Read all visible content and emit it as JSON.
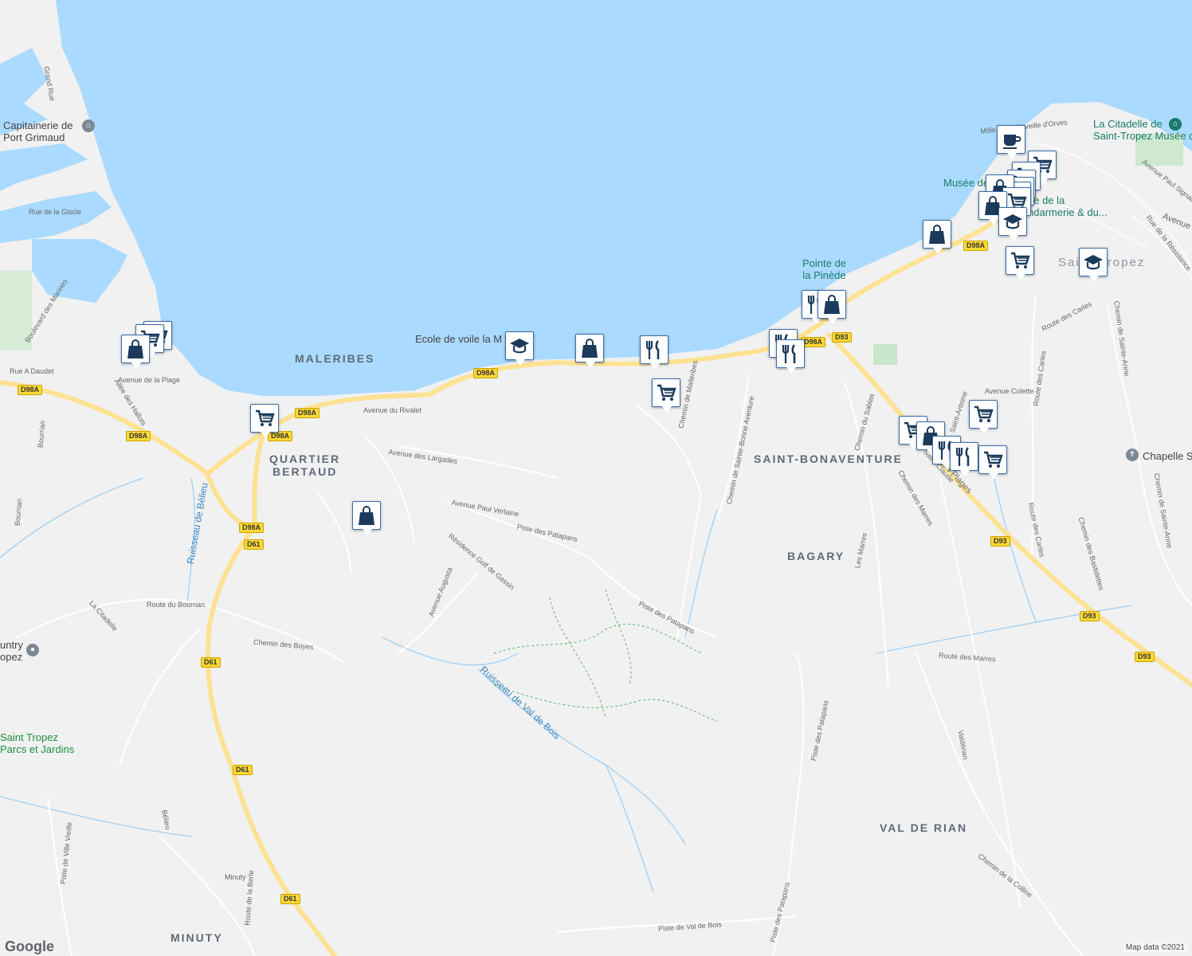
{
  "areas": {
    "malerbes": "MALERIBES",
    "quartier": "QUARTIER",
    "bertaud": "BERTAUD",
    "saint_bonaventure": "SAINT-BONAVENTURE",
    "bagary": "BAGARY",
    "val_de_rian": "VAL DE RIAN",
    "minuty": "MINUTY"
  },
  "pois": {
    "capitainerie_1": "Capitainerie de",
    "capitainerie_2": "Port Grimaud",
    "ecole_voile": "Ecole de voile la M",
    "pointe_1": "Pointe de",
    "pointe_2": "la Pinède",
    "citadelle_1": "La Citadelle de",
    "citadelle_2": "Saint-Tropez Musée d...",
    "musee_1": "Musée de",
    "musee_2": "ée de la",
    "musee_3": "ndarmerie & du...",
    "saint_tropez": "Saint-Tropez",
    "chapelle": "Chapelle S",
    "country_1": "untry",
    "country_2": "opez",
    "parcs_1": "Saint Tropez",
    "parcs_2": "Parcs et Jardins"
  },
  "streets": {
    "grand_rue": "Grand Rue",
    "rue_giscle": "Rue de la Giscle",
    "bd_marines": "Boulevard des Marines",
    "rue_daudet": "Rue A Daudet",
    "av_plage": "Avenue de la Plage",
    "allee_hallots": "Allée des Hallots",
    "bourrian_1": "Bourrian",
    "bourrian_2": "Bourrian",
    "av_rivalet": "Avenue du Rivalet",
    "av_largades": "Avenue des Largades",
    "av_verlaine": "Avenue Paul Verlaine",
    "piste_patapans_1": "Piste des Patapans",
    "piste_patapans_2": "Piste des Patapans",
    "piste_patapans_3": "Piste des Patapans",
    "piste_patapans_4": "Piste des Patapans",
    "res_golf": "Résidence Golf de Gassin",
    "av_augusta": "Avenue Augusta",
    "route_bourrian": "Route du Bourrian",
    "chemin_boyes": "Chemin des Boyes",
    "chemin_malleribes": "Chemin de Malleribes",
    "chemin_bonaventure": "Chemin de Sainte-Bonne Aventure",
    "chemin_sablas": "Chemin du Sablas",
    "av_colette": "Avenue Colette",
    "route_carles_1": "Route des Carles",
    "route_carles_2": "Route des Carles",
    "route_carles_3": "Route des Carles",
    "chemin_ste_anne_1": "Chemin de Sainte-Anne",
    "chemin_ste_anne_2": "Chemin de Sainte-Anne",
    "av_signac": "Avenue Paul Signac",
    "rue_resistance": "Rue de la Résistance",
    "avenue_partial": "Avenue",
    "route_marres": "Route des Marres",
    "chemin_marres": "Chemin des Marres",
    "les_marres": "Les Marres",
    "chemin_bastidettes": "Chemin des Bastidettes",
    "valderian": "Valdérian",
    "chemin_colline": "Chemin de la Colline",
    "piste_val_bois": "Piste de Val de Bois",
    "route_berle": "Route de la Berle",
    "minuty_st": "Minuty",
    "piste_ville_vieille": "Piste de Ville Vieille",
    "belieu": "Bélieu",
    "la_citadelle_st": "La Citadelle",
    "saint_antoine": "Saint-Antoine",
    "saint_claude": "Saint-Claude",
    "des_plages": "des Plages",
    "mole": "Môle Jean-Réveille d'Orves"
  },
  "waterways": {
    "ruisseau_belieu": "Ruisseau de Bélieu",
    "ruisseau_val_bois": "Ruisseau de Val de Bois"
  },
  "roads": {
    "d98a_1": "D98A",
    "d98a_2": "D98A",
    "d98a_3": "D98A",
    "d98a_4": "D98A",
    "d98a_5": "D98A",
    "d98a_6": "D98A",
    "d98a_7": "D98A",
    "d98a_8": "D98A",
    "d61_1": "D61",
    "d61_2": "D61",
    "d61_3": "D61",
    "d61_4": "D61",
    "d93_1": "D93",
    "d93_2": "D93",
    "d93_3": "D93",
    "d93_4": "D93"
  },
  "attribution": "Map data ©2021",
  "logo": "Google",
  "colors": {
    "sea": "#aadaff",
    "land": "#f1f1f1",
    "road": "#fde293",
    "marker_icon": "#1b3a5c",
    "park": "#c8e6c9"
  }
}
